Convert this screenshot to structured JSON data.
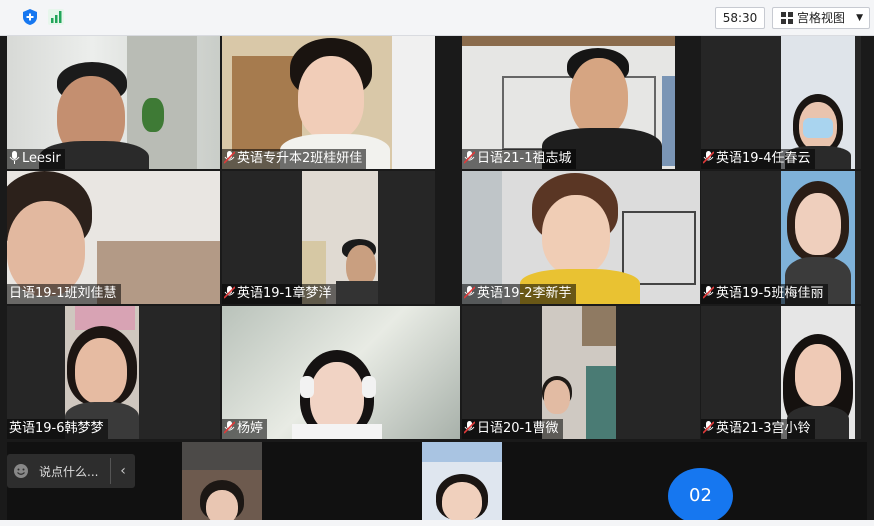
{
  "toolbar": {
    "timer": "58:30",
    "view_mode": "宫格视图"
  },
  "participants": [
    {
      "name": "Leesir"
    },
    {
      "name": "英语专升本2班桂妍佳"
    },
    {
      "name": "日语21-1祖志城"
    },
    {
      "name": "英语19-4任春云"
    },
    {
      "name": "日语19-1班刘佳慧"
    },
    {
      "name": "英语19-1章梦洋"
    },
    {
      "name": "英语19-2李新芋"
    },
    {
      "name": "英语19-5班梅佳丽"
    },
    {
      "name": "英语19-6韩梦梦"
    },
    {
      "name": "杨婷"
    },
    {
      "name": "日语20-1曹微"
    },
    {
      "name": "英语21-3宫小铃"
    }
  ],
  "chat": {
    "placeholder": "说点什么..."
  },
  "page_indicator": "02",
  "colors": {
    "active_border": "#25b86a",
    "badge": "#1677f0",
    "mic_muted": "#e03a3a"
  }
}
